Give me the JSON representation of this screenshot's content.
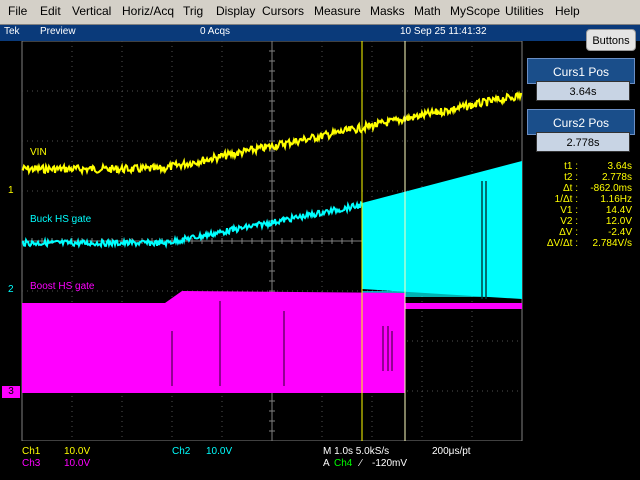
{
  "menu": [
    "File",
    "Edit",
    "Vertical",
    "Horiz/Acq",
    "Trig",
    "Display",
    "Cursors",
    "Measure",
    "Masks",
    "Math",
    "MyScope",
    "Utilities",
    "Help"
  ],
  "status": {
    "brand": "Tek",
    "mode": "Preview",
    "acqs": "0 Acqs",
    "datetime": "10 Sep 25 11:41:32"
  },
  "buttons_label": "Buttons",
  "cursors": {
    "curs1_label": "Curs1 Pos",
    "curs1_value": "3.64s",
    "curs2_label": "Curs2 Pos",
    "curs2_value": "2.778s"
  },
  "measurements": [
    {
      "label": "t1 :",
      "value": "3.64s"
    },
    {
      "label": "t2 :",
      "value": "2.778s"
    },
    {
      "label": "Δt :",
      "value": "-862.0ms"
    },
    {
      "label": "1/Δt :",
      "value": "1.16Hz"
    },
    {
      "label": "V1 :",
      "value": "14.4V"
    },
    {
      "label": "V2 :",
      "value": "12.0V"
    },
    {
      "label": "ΔV :",
      "value": "-2.4V"
    },
    {
      "label": "ΔV/Δt :",
      "value": "2.784V/s"
    }
  ],
  "traces": {
    "vin": "VIN",
    "buck": "Buck HS gate",
    "boost": "Boost HS gate"
  },
  "markers": {
    "ch1": "1",
    "ch2": "2",
    "ch3": "3"
  },
  "bottom": {
    "ch1": "Ch1",
    "ch1_scale": "10.0V",
    "ch2": "Ch2",
    "ch2_scale": "10.0V",
    "ch3": "Ch3",
    "ch3_scale": "10.0V",
    "timebase": "M 1.0s 5.0kS/s",
    "record": "200μs/pt",
    "trig_a": "A",
    "trig_ch": "Ch4",
    "trig_slope": "∕",
    "trig_level": "-120mV"
  },
  "colors": {
    "ch1": "#ffff00",
    "ch2": "#00ffff",
    "ch3": "#ff00ff",
    "ch4": "#00ff00",
    "grid": "#808080"
  }
}
